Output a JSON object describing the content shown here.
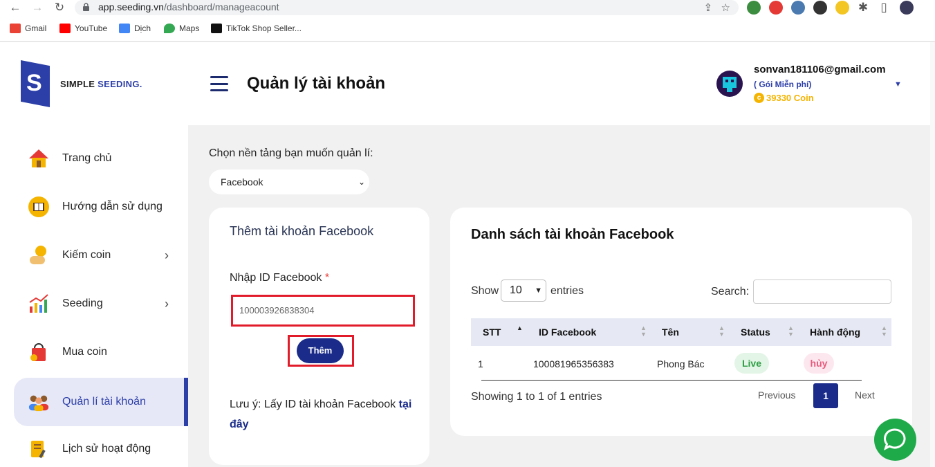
{
  "browser": {
    "url_host": "app.seeding.vn",
    "url_path": "/dashboard/manageacount",
    "bookmarks": [
      "Gmail",
      "YouTube",
      "Dịch",
      "Maps",
      "TikTok Shop Seller..."
    ]
  },
  "brand": {
    "letter": "S",
    "name_part1": "SIMPLE",
    "name_part2": "SEEDING."
  },
  "sidebar": {
    "items": [
      {
        "label": "Trang chủ"
      },
      {
        "label": "Hướng dẫn sử dụng"
      },
      {
        "label": "Kiếm coin"
      },
      {
        "label": "Seeding"
      },
      {
        "label": "Mua coin"
      },
      {
        "label": "Quản lí tài khoản"
      },
      {
        "label": "Lịch sử hoạt động"
      }
    ]
  },
  "header": {
    "title": "Quản lý tài khoản",
    "user_email": "sonvan181106@gmail.com",
    "user_plan": "( Gói Miễn phí)",
    "user_coin": "39330 Coin"
  },
  "platform": {
    "label": "Chọn nền tảng bạn muốn quản lí:",
    "selected": "Facebook"
  },
  "add_card": {
    "title": "Thêm tài khoản Facebook",
    "id_label": "Nhập ID Facebook",
    "required_mark": "*",
    "id_value": "100003926838304",
    "button_label": "Thêm",
    "note_text": "Lưu ý: Lấy ID tài khoản Facebook ",
    "note_link": "tại đây"
  },
  "list_card": {
    "title": "Danh sách tài khoản Facebook",
    "show_label": "Show",
    "entries_value": "10",
    "entries_label": "entries",
    "search_label": "Search:",
    "columns": [
      "STT",
      "ID Facebook",
      "Tên",
      "Status",
      "Hành động"
    ],
    "rows": [
      {
        "stt": "1",
        "id": "100081965356383",
        "name": "Phong Bác",
        "status": "Live",
        "action": "hủy"
      }
    ],
    "info": "Showing 1 to 1 of 1 entries",
    "prev": "Previous",
    "page": "1",
    "next": "Next"
  },
  "colors": {
    "primary": "#1a2b8a",
    "highlight_red": "#e21b2b",
    "coin": "#f4b400",
    "chat": "#1faa4a"
  }
}
